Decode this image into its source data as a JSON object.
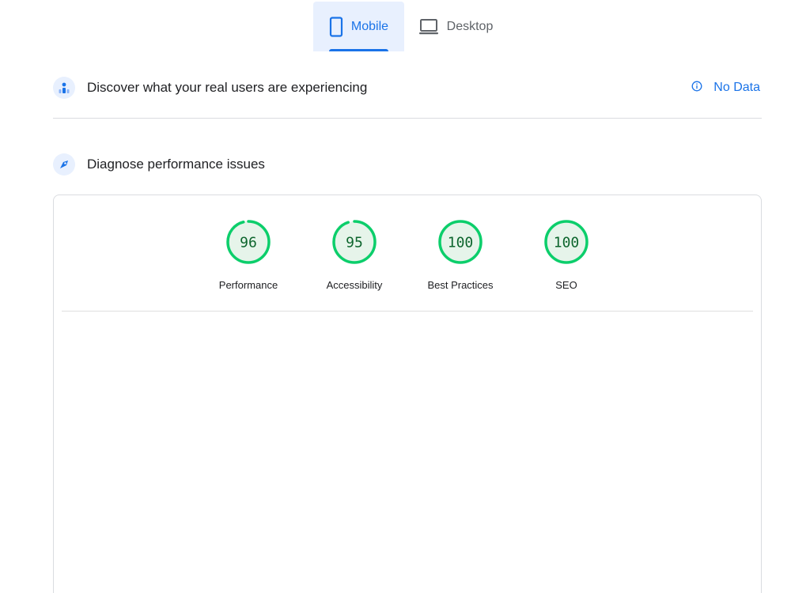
{
  "tabs": {
    "mobile_label": "Mobile",
    "desktop_label": "Desktop",
    "selected": "Mobile"
  },
  "crux_section": {
    "title": "Discover what your real users are experiencing",
    "status_label": "No Data",
    "icon": "users-icon"
  },
  "diagnose_section": {
    "title": "Diagnose performance issues",
    "icon": "lighthouse-icon"
  },
  "scores": [
    {
      "label": "Performance",
      "value": 96
    },
    {
      "label": "Accessibility",
      "value": 95
    },
    {
      "label": "Best Practices",
      "value": 100
    },
    {
      "label": "SEO",
      "value": 100
    }
  ],
  "colors": {
    "accent": "#1a73e8",
    "pass_ring": "#0cce6b",
    "pass_fill": "#e6f4ea",
    "pass_text": "#0d652d",
    "divider": "#dadce0"
  }
}
